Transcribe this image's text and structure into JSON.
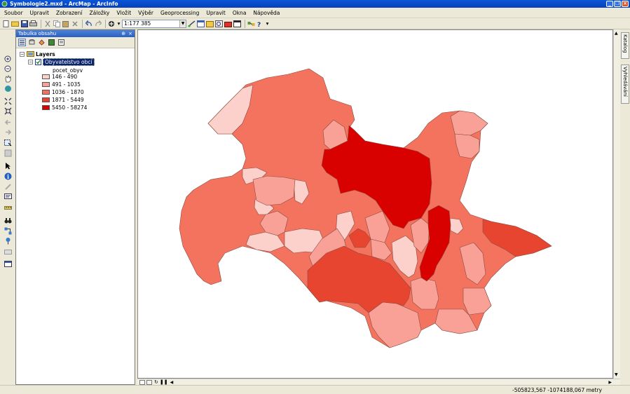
{
  "window": {
    "title": "Symbologie2.mxd - ArcMap - ArcInfo"
  },
  "menu": [
    "Soubor",
    "Upravit",
    "Zobrazení",
    "Záložky",
    "Vložit",
    "Výběr",
    "Geoprocessing",
    "Upravit",
    "Okna",
    "Nápověda"
  ],
  "toolbar": {
    "scale": "1:177 385"
  },
  "toc": {
    "title": "Tabulka obsahu",
    "root": "Layers",
    "layer": "Obyvatelstvo obcí",
    "field": "pocet_obyv",
    "legend": [
      {
        "label": "146 - 490",
        "color": "#fcd0cb"
      },
      {
        "label": "491 - 1035",
        "color": "#f9a196"
      },
      {
        "label": "1036 - 1870",
        "color": "#f4735f"
      },
      {
        "label": "1871 - 5449",
        "color": "#e84530"
      },
      {
        "label": "5450 - 58274",
        "color": "#d90000"
      }
    ]
  },
  "dock": {
    "tab1": "Katalog",
    "tab2": "Vyhledávání"
  },
  "status": {
    "coords": "-505823,567  -1074188,067 metry"
  }
}
